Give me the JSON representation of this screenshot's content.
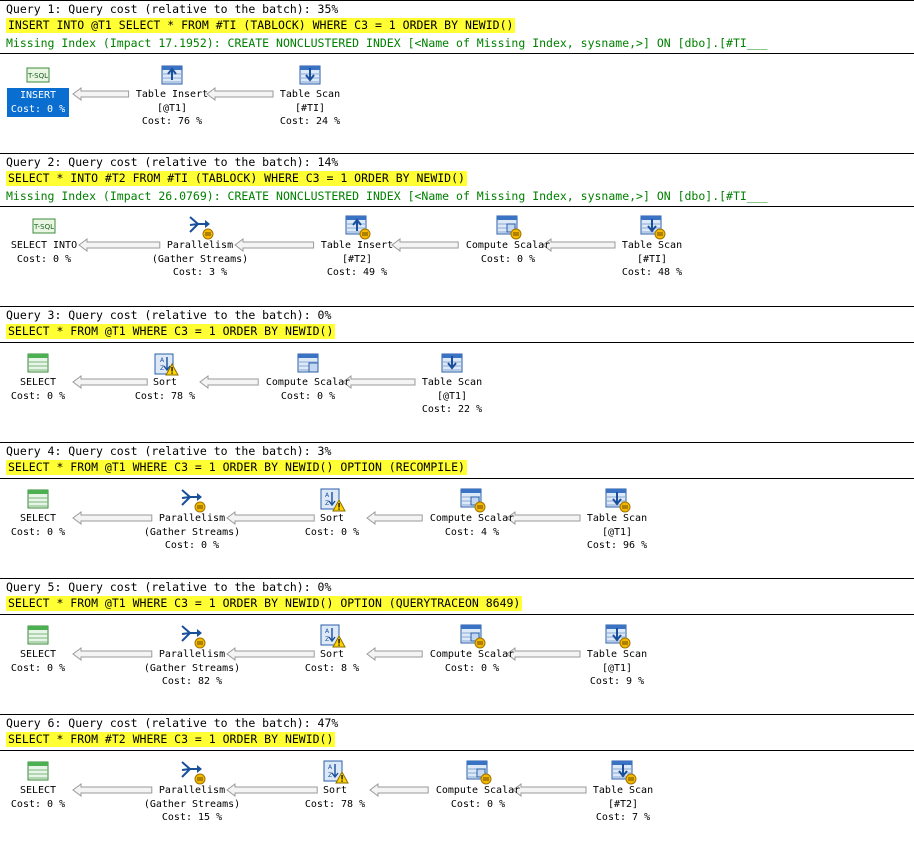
{
  "queries": [
    {
      "header": "Query 1: Query cost (relative to the batch): 35%",
      "sql": "INSERT INTO @T1 SELECT * FROM #TI (TABLOCK) WHERE C3 = 1 ORDER BY NEWID()",
      "missing": "Missing Index (Impact 17.1952): CREATE NONCLUSTERED INDEX [<Name of Missing Index, sysname,>] ON [dbo].[#TI___",
      "nodes": [
        {
          "icon": "tsql",
          "lines": [
            "INSERT",
            "Cost: 0 %"
          ],
          "selected": true
        },
        {
          "icon": "insert",
          "lines": [
            "Table Insert",
            "[@T1]",
            "Cost: 76 %"
          ]
        },
        {
          "icon": "scan",
          "lines": [
            "Table Scan",
            "[#TI]",
            "Cost: 24 %"
          ]
        }
      ]
    },
    {
      "header": "Query 2: Query cost (relative to the batch): 14%",
      "sql": "SELECT * INTO #T2 FROM #TI (TABLOCK) WHERE C3 = 1 ORDER BY NEWID()",
      "missing": "Missing Index (Impact 26.0769): CREATE NONCLUSTERED INDEX [<Name of Missing Index, sysname,>] ON [dbo].[#TI___",
      "nodes": [
        {
          "icon": "tsql",
          "lines": [
            "SELECT INTO",
            "Cost: 0 %"
          ]
        },
        {
          "icon": "parallel",
          "lines": [
            "Parallelism",
            "(Gather Streams)",
            "Cost: 3 %"
          ]
        },
        {
          "icon": "insert-par",
          "lines": [
            "Table Insert",
            "[#T2]",
            "Cost: 49 %"
          ]
        },
        {
          "icon": "compute-par",
          "lines": [
            "Compute Scalar",
            "Cost: 0 %"
          ]
        },
        {
          "icon": "scan-par",
          "lines": [
            "Table Scan",
            "[#TI]",
            "Cost: 48 %"
          ]
        }
      ]
    },
    {
      "header": "Query 3: Query cost (relative to the batch): 0%",
      "sql": "SELECT * FROM @T1 WHERE C3 = 1 ORDER BY NEWID()",
      "missing": "",
      "nodes": [
        {
          "icon": "select",
          "lines": [
            "SELECT",
            "Cost: 0 %"
          ]
        },
        {
          "icon": "sort-warn",
          "lines": [
            "Sort",
            "Cost: 78 %"
          ]
        },
        {
          "icon": "compute",
          "lines": [
            "Compute Scalar",
            "Cost: 0 %"
          ]
        },
        {
          "icon": "scan",
          "lines": [
            "Table Scan",
            "[@T1]",
            "Cost: 22 %"
          ]
        }
      ]
    },
    {
      "header": "Query 4: Query cost (relative to the batch): 3%",
      "sql": "SELECT * FROM @T1 WHERE C3 = 1 ORDER BY NEWID() OPTION (RECOMPILE)",
      "missing": "",
      "nodes": [
        {
          "icon": "select",
          "lines": [
            "SELECT",
            "Cost: 0 %"
          ]
        },
        {
          "icon": "parallel",
          "lines": [
            "Parallelism",
            "(Gather Streams)",
            "Cost: 0 %"
          ]
        },
        {
          "icon": "sort-warn-par",
          "lines": [
            "Sort",
            "Cost: 0 %"
          ]
        },
        {
          "icon": "compute-par",
          "lines": [
            "Compute Scalar",
            "Cost: 4 %"
          ]
        },
        {
          "icon": "scan-par",
          "lines": [
            "Table Scan",
            "[@T1]",
            "Cost: 96 %"
          ]
        }
      ]
    },
    {
      "header": "Query 5: Query cost (relative to the batch): 0%",
      "sql": "SELECT * FROM @T1 WHERE C3 = 1 ORDER BY NEWID() OPTION (QUERYTRACEON 8649)",
      "missing": "",
      "nodes": [
        {
          "icon": "select",
          "lines": [
            "SELECT",
            "Cost: 0 %"
          ]
        },
        {
          "icon": "parallel",
          "lines": [
            "Parallelism",
            "(Gather Streams)",
            "Cost: 82 %"
          ]
        },
        {
          "icon": "sort-warn-par",
          "lines": [
            "Sort",
            "Cost: 8 %"
          ]
        },
        {
          "icon": "compute-par",
          "lines": [
            "Compute Scalar",
            "Cost: 0 %"
          ]
        },
        {
          "icon": "scan-par",
          "lines": [
            "Table Scan",
            "[@T1]",
            "Cost: 9 %"
          ]
        }
      ]
    },
    {
      "header": "Query 6: Query cost (relative to the batch): 47%",
      "sql": "SELECT * FROM #T2 WHERE C3 = 1 ORDER BY NEWID()",
      "missing": "",
      "nodes": [
        {
          "icon": "select",
          "lines": [
            "SELECT",
            "Cost: 0 %"
          ]
        },
        {
          "icon": "parallel",
          "lines": [
            "Parallelism",
            "(Gather Streams)",
            "Cost: 15 %"
          ]
        },
        {
          "icon": "sort-warn-par",
          "lines": [
            "Sort",
            "Cost: 78 %"
          ]
        },
        {
          "icon": "compute-par",
          "lines": [
            "Compute Scalar",
            "Cost: 0 %"
          ]
        },
        {
          "icon": "scan-par",
          "lines": [
            "Table Scan",
            "[#T2]",
            "Cost: 7 %"
          ]
        }
      ]
    }
  ],
  "icon_labels": {
    "tsql": "T-SQL"
  },
  "colors": {
    "highlight": "#ffff33",
    "missing_index": "#008000",
    "selected": "#0a6ed1"
  }
}
